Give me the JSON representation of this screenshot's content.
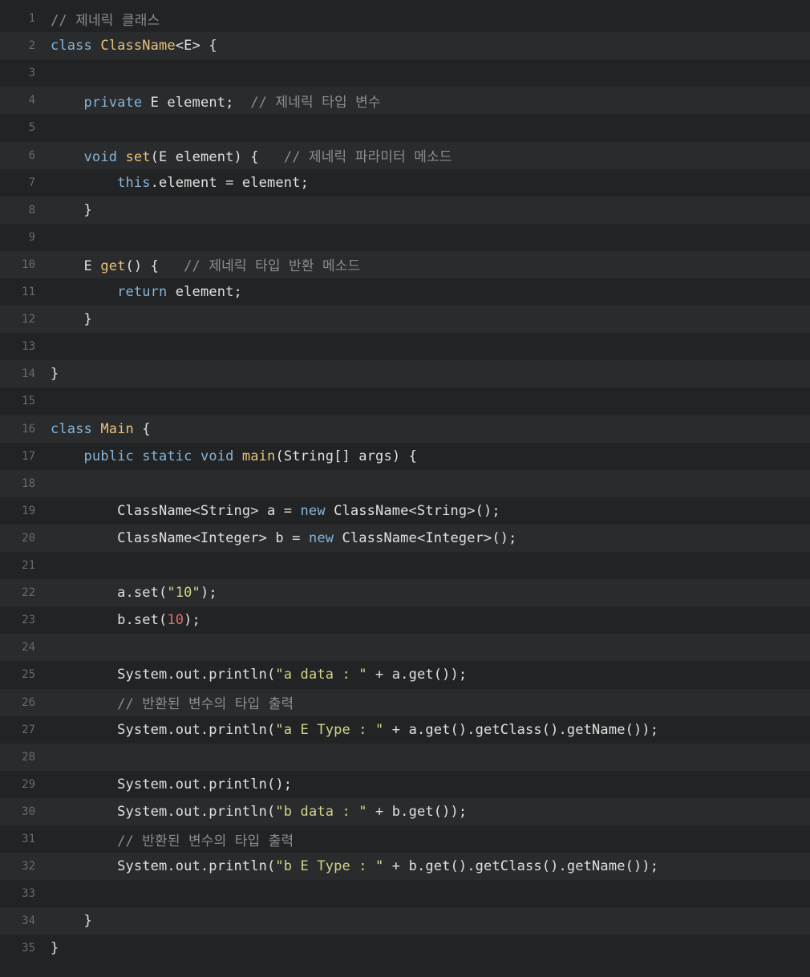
{
  "colors": {
    "background": "#222324",
    "alt_row": "#2a2b2d",
    "line_number": "#676b70",
    "keyword": "#86b4d8",
    "function": "#e8c17a",
    "string": "#d1d58a",
    "number": "#e46b6b",
    "comment": "#8a8d90",
    "plain": "#e0e0e0"
  },
  "lines": [
    {
      "n": "1",
      "tokens": [
        {
          "t": "cm",
          "v": "// 제네릭 클래스"
        }
      ]
    },
    {
      "n": "2",
      "tokens": [
        {
          "t": "kw",
          "v": "class"
        },
        {
          "t": "pl",
          "v": " "
        },
        {
          "t": "fn",
          "v": "ClassName"
        },
        {
          "t": "pl",
          "v": "<E> {"
        }
      ]
    },
    {
      "n": "3",
      "tokens": []
    },
    {
      "n": "4",
      "tokens": [
        {
          "t": "pl",
          "v": "    "
        },
        {
          "t": "kw",
          "v": "private"
        },
        {
          "t": "pl",
          "v": " E element;  "
        },
        {
          "t": "cm",
          "v": "// 제네릭 타입 변수"
        }
      ]
    },
    {
      "n": "5",
      "tokens": []
    },
    {
      "n": "6",
      "tokens": [
        {
          "t": "pl",
          "v": "    "
        },
        {
          "t": "kw",
          "v": "void"
        },
        {
          "t": "pl",
          "v": " "
        },
        {
          "t": "fn",
          "v": "set"
        },
        {
          "t": "pl",
          "v": "(E element) {   "
        },
        {
          "t": "cm",
          "v": "// 제네릭 파라미터 메소드"
        }
      ]
    },
    {
      "n": "7",
      "tokens": [
        {
          "t": "pl",
          "v": "        "
        },
        {
          "t": "kw",
          "v": "this"
        },
        {
          "t": "pl",
          "v": ".element = element;"
        }
      ]
    },
    {
      "n": "8",
      "tokens": [
        {
          "t": "pl",
          "v": "    }"
        }
      ]
    },
    {
      "n": "9",
      "tokens": []
    },
    {
      "n": "10",
      "tokens": [
        {
          "t": "pl",
          "v": "    E "
        },
        {
          "t": "fn",
          "v": "get"
        },
        {
          "t": "pl",
          "v": "() {   "
        },
        {
          "t": "cm",
          "v": "// 제네릭 타입 반환 메소드"
        }
      ]
    },
    {
      "n": "11",
      "tokens": [
        {
          "t": "pl",
          "v": "        "
        },
        {
          "t": "kw",
          "v": "return"
        },
        {
          "t": "pl",
          "v": " element;"
        }
      ]
    },
    {
      "n": "12",
      "tokens": [
        {
          "t": "pl",
          "v": "    }"
        }
      ]
    },
    {
      "n": "13",
      "tokens": []
    },
    {
      "n": "14",
      "tokens": [
        {
          "t": "pl",
          "v": "}"
        }
      ]
    },
    {
      "n": "15",
      "tokens": []
    },
    {
      "n": "16",
      "tokens": [
        {
          "t": "kw",
          "v": "class"
        },
        {
          "t": "pl",
          "v": " "
        },
        {
          "t": "fn",
          "v": "Main"
        },
        {
          "t": "pl",
          "v": " {"
        }
      ]
    },
    {
      "n": "17",
      "tokens": [
        {
          "t": "pl",
          "v": "    "
        },
        {
          "t": "kw",
          "v": "public"
        },
        {
          "t": "pl",
          "v": " "
        },
        {
          "t": "kw",
          "v": "static"
        },
        {
          "t": "pl",
          "v": " "
        },
        {
          "t": "kw",
          "v": "void"
        },
        {
          "t": "pl",
          "v": " "
        },
        {
          "t": "fn",
          "v": "main"
        },
        {
          "t": "pl",
          "v": "(String[] args) {"
        }
      ]
    },
    {
      "n": "18",
      "tokens": []
    },
    {
      "n": "19",
      "tokens": [
        {
          "t": "pl",
          "v": "        ClassName<String> a = "
        },
        {
          "t": "kw",
          "v": "new"
        },
        {
          "t": "pl",
          "v": " ClassName<String>();"
        }
      ]
    },
    {
      "n": "20",
      "tokens": [
        {
          "t": "pl",
          "v": "        ClassName<Integer> b = "
        },
        {
          "t": "kw",
          "v": "new"
        },
        {
          "t": "pl",
          "v": " ClassName<Integer>();"
        }
      ]
    },
    {
      "n": "21",
      "tokens": []
    },
    {
      "n": "22",
      "tokens": [
        {
          "t": "pl",
          "v": "        a.set("
        },
        {
          "t": "str",
          "v": "\"10\""
        },
        {
          "t": "pl",
          "v": ");"
        }
      ]
    },
    {
      "n": "23",
      "tokens": [
        {
          "t": "pl",
          "v": "        b.set("
        },
        {
          "t": "num",
          "v": "10"
        },
        {
          "t": "pl",
          "v": ");"
        }
      ]
    },
    {
      "n": "24",
      "tokens": []
    },
    {
      "n": "25",
      "tokens": [
        {
          "t": "pl",
          "v": "        System.out.println("
        },
        {
          "t": "str",
          "v": "\"a data : \""
        },
        {
          "t": "pl",
          "v": " + a.get());"
        }
      ]
    },
    {
      "n": "26",
      "tokens": [
        {
          "t": "pl",
          "v": "        "
        },
        {
          "t": "cm",
          "v": "// 반환된 변수의 타입 출력"
        }
      ]
    },
    {
      "n": "27",
      "tokens": [
        {
          "t": "pl",
          "v": "        System.out.println("
        },
        {
          "t": "str",
          "v": "\"a E Type : \""
        },
        {
          "t": "pl",
          "v": " + a.get().getClass().getName());"
        }
      ]
    },
    {
      "n": "28",
      "tokens": []
    },
    {
      "n": "29",
      "tokens": [
        {
          "t": "pl",
          "v": "        System.out.println();"
        }
      ]
    },
    {
      "n": "30",
      "tokens": [
        {
          "t": "pl",
          "v": "        System.out.println("
        },
        {
          "t": "str",
          "v": "\"b data : \""
        },
        {
          "t": "pl",
          "v": " + b.get());"
        }
      ]
    },
    {
      "n": "31",
      "tokens": [
        {
          "t": "pl",
          "v": "        "
        },
        {
          "t": "cm",
          "v": "// 반환된 변수의 타입 출력"
        }
      ]
    },
    {
      "n": "32",
      "tokens": [
        {
          "t": "pl",
          "v": "        System.out.println("
        },
        {
          "t": "str",
          "v": "\"b E Type : \""
        },
        {
          "t": "pl",
          "v": " + b.get().getClass().getName());"
        }
      ]
    },
    {
      "n": "33",
      "tokens": []
    },
    {
      "n": "34",
      "tokens": [
        {
          "t": "pl",
          "v": "    }"
        }
      ]
    },
    {
      "n": "35",
      "tokens": [
        {
          "t": "pl",
          "v": "}"
        }
      ]
    }
  ]
}
